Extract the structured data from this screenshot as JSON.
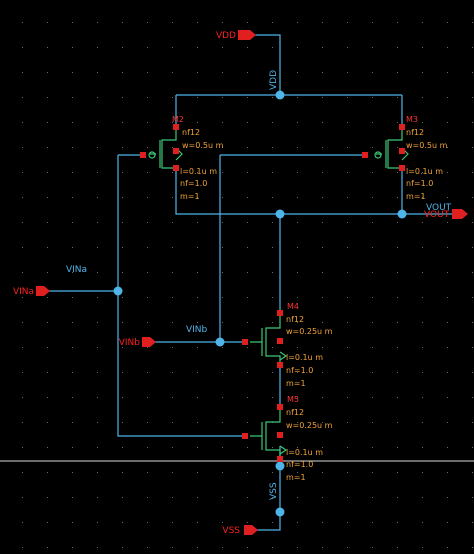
{
  "pins": {
    "vdd": "VDD",
    "vina": "VINa",
    "vinb": "VINb",
    "vout": "VOUT",
    "vss": "VSS"
  },
  "nets": {
    "vdd": "VDD",
    "vina": "VINa",
    "vinb": "VINb",
    "vout": "VOUT",
    "vss": "VSS"
  },
  "devices": {
    "m2": {
      "name": "M2",
      "nf_top": "nf12",
      "w": "w=0.5u m",
      "l": "l=0.1u m",
      "nf": "nf=1.0",
      "m": "m=1"
    },
    "m3": {
      "name": "M3",
      "nf_top": "nf12",
      "w": "w=0.5u m",
      "l": "l=0.1u m",
      "nf": "nf=1.0",
      "m": "m=1"
    },
    "m4": {
      "name": "M4",
      "nf_top": "nf12",
      "w": "w=0.25u m",
      "l": "l=0.1u m",
      "nf": "nf=1.0",
      "m": "m=1"
    },
    "m5": {
      "name": "M5",
      "nf_top": "nf12",
      "w": "w=0.25u m",
      "l": "l=0.1u m",
      "nf": "nf=1.0",
      "m": "m=1"
    }
  },
  "colors": {
    "background": "#000000",
    "wire": "#4fb4e8",
    "device": "#3cc878",
    "pin": "#e02020",
    "annotation": "#f0a23a"
  }
}
